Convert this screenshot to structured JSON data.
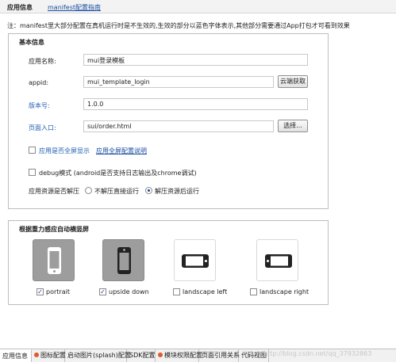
{
  "header": {
    "tab_app_info": "应用信息",
    "link_manifest_guide": "manifest配置指南"
  },
  "note": "注：manifest里大部分配置在真机运行时是不生效的,生效的部分以蓝色字体表示,其他部分需要通过App打包才可看到效果",
  "basic": {
    "title": "基本信息",
    "app_name_label": "应用名称:",
    "app_name_value": "mui登录模板",
    "appid_label": "appid:",
    "appid_value": "mui_template_login",
    "cloud_fetch_button": "云端获取",
    "version_label": "版本号:",
    "version_value": "1.0.0",
    "entry_label": "页面入口:",
    "entry_value": "sui/order.html",
    "choose_button": "选择...",
    "fullscreen_label": "应用是否全屏显示",
    "fullscreen_link": "应用全屏配置说明",
    "fullscreen_checked": false,
    "debug_label": "debug模式 (android是否支持日志输出及chrome调试)",
    "debug_checked": false,
    "unzip_label": "应用资源是否解压",
    "unzip_option_no": "不解压直接运行",
    "unzip_option_yes": "解压资源后运行",
    "unzip_selected": "解压资源后运行"
  },
  "orientation": {
    "title": "根据重力感应自动横竖屏",
    "options": [
      {
        "icon": "phone-portrait-icon",
        "label": "portrait",
        "checked": true
      },
      {
        "icon": "phone-upside-down-icon",
        "label": "upside down",
        "checked": true
      },
      {
        "icon": "phone-landscape-left-icon",
        "label": "landscape left",
        "checked": false
      },
      {
        "icon": "phone-landscape-right-icon",
        "label": "landscape right",
        "checked": false
      }
    ]
  },
  "bottom_tabs": [
    {
      "label": "应用信息",
      "active": true,
      "warn": false
    },
    {
      "label": "图标配置",
      "active": false,
      "warn": true
    },
    {
      "label": "启动图片(splash)配置",
      "active": false,
      "warn": false
    },
    {
      "label": "SDK配置",
      "active": false,
      "warn": false
    },
    {
      "label": "模块权限配置",
      "active": false,
      "warn": true
    },
    {
      "label": "页面引用关系",
      "active": false,
      "warn": false
    },
    {
      "label": "代码视图",
      "active": false,
      "warn": false
    }
  ],
  "watermark": "http://blog.csdn.net/qq_37932863",
  "colors": {
    "blue_label": "#1f5fb3",
    "link": "#1a4da1",
    "selected_tile": "#9d9d9d"
  }
}
